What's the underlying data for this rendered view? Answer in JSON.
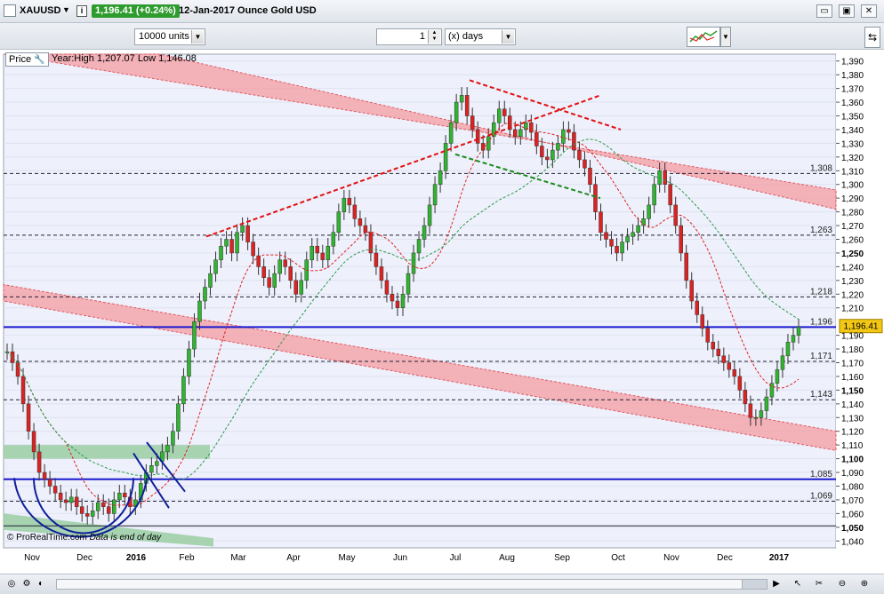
{
  "header": {
    "symbol": "XAUUSD",
    "price_badge": "1,196.41 (+0.24%)",
    "description": "12-Jan-2017 Ounce Gold USD",
    "badge_color": "#2e9b2e"
  },
  "toolbar": {
    "units": "10000 units",
    "period_value": "1",
    "period_unit": "(x) days"
  },
  "chart_header": {
    "price_label": "Price",
    "year_high_low": "Year:High 1,207.07 Low 1,146.08"
  },
  "credit": {
    "source": "© ProRealTime.com",
    "note": "Data is end of day"
  },
  "chart_data": {
    "type": "candlestick",
    "x_labels": [
      "Nov",
      "Dec",
      "2016",
      "Feb",
      "Mar",
      "Apr",
      "May",
      "Jun",
      "Jul",
      "Aug",
      "Sep",
      "Oct",
      "Nov",
      "Dec",
      "2017"
    ],
    "y_ticks": [
      1040,
      1050,
      1060,
      1070,
      1080,
      1090,
      1100,
      1110,
      1120,
      1130,
      1140,
      1150,
      1160,
      1170,
      1180,
      1190,
      1200,
      1210,
      1220,
      1230,
      1240,
      1250,
      1260,
      1270,
      1280,
      1290,
      1300,
      1310,
      1320,
      1330,
      1340,
      1350,
      1360,
      1370,
      1380,
      1390
    ],
    "y_tick_labels": [
      "1,040",
      "1,050",
      "1,060",
      "1,070",
      "1,080",
      "1,090",
      "1,100",
      "1,110",
      "1,120",
      "1,130",
      "1,140",
      "1,150",
      "1,160",
      "1,170",
      "1,180",
      "1,190",
      "1,200",
      "1,210",
      "1,220",
      "1,230",
      "1,240",
      "1,250",
      "1,260",
      "1,270",
      "1,280",
      "1,290",
      "1,300",
      "1,310",
      "1,320",
      "1,330",
      "1,340",
      "1,350",
      "1,360",
      "1,370",
      "1,380",
      "1,390"
    ],
    "bold_ticks": [
      1050,
      1100,
      1150,
      1250
    ],
    "ylim": [
      1035,
      1395
    ],
    "last_price": 1196.41,
    "last_price_label": "1,196.41",
    "horizontal_levels": [
      {
        "value": 1308,
        "label": "1,308",
        "style": "dashed"
      },
      {
        "value": 1263,
        "label": "1,263",
        "style": "dashed"
      },
      {
        "value": 1218,
        "label": "1,218",
        "style": "dashed"
      },
      {
        "value": 1196,
        "label": "1,196",
        "style": "solid-blue"
      },
      {
        "value": 1171,
        "label": "1,171",
        "style": "dashed"
      },
      {
        "value": 1143,
        "label": "1,143",
        "style": "dashed"
      },
      {
        "value": 1085,
        "label": "1,085",
        "style": "solid-blue"
      },
      {
        "value": 1069,
        "label": "1,069",
        "style": "dashed"
      },
      {
        "value": 1051,
        "label": "",
        "style": "solid-dark"
      }
    ],
    "closes": [
      1178,
      1170,
      1160,
      1140,
      1120,
      1105,
      1090,
      1085,
      1080,
      1075,
      1070,
      1068,
      1072,
      1065,
      1060,
      1058,
      1062,
      1068,
      1065,
      1060,
      1070,
      1075,
      1072,
      1065,
      1070,
      1082,
      1090,
      1095,
      1098,
      1105,
      1110,
      1120,
      1140,
      1160,
      1180,
      1200,
      1215,
      1225,
      1235,
      1245,
      1255,
      1260,
      1250,
      1265,
      1270,
      1258,
      1248,
      1240,
      1232,
      1225,
      1235,
      1245,
      1240,
      1230,
      1220,
      1230,
      1245,
      1255,
      1250,
      1245,
      1255,
      1265,
      1280,
      1290,
      1285,
      1275,
      1270,
      1265,
      1250,
      1240,
      1230,
      1220,
      1215,
      1210,
      1220,
      1235,
      1250,
      1260,
      1270,
      1285,
      1300,
      1310,
      1330,
      1345,
      1360,
      1365,
      1350,
      1340,
      1330,
      1325,
      1335,
      1345,
      1355,
      1350,
      1340,
      1335,
      1340,
      1345,
      1338,
      1328,
      1320,
      1318,
      1325,
      1330,
      1340,
      1338,
      1325,
      1318,
      1312,
      1300,
      1280,
      1265,
      1260,
      1255,
      1250,
      1258,
      1262,
      1265,
      1270,
      1275,
      1285,
      1300,
      1310,
      1300,
      1285,
      1270,
      1250,
      1230,
      1215,
      1205,
      1195,
      1185,
      1180,
      1175,
      1170,
      1165,
      1160,
      1150,
      1140,
      1130,
      1130,
      1135,
      1145,
      1155,
      1165,
      1175,
      1185,
      1190,
      1196
    ],
    "annotations": [
      "upper pink channel",
      "lower pink channel",
      "green zones",
      "dashed moving averages",
      "red dashed trend lines",
      "blue arc"
    ]
  }
}
